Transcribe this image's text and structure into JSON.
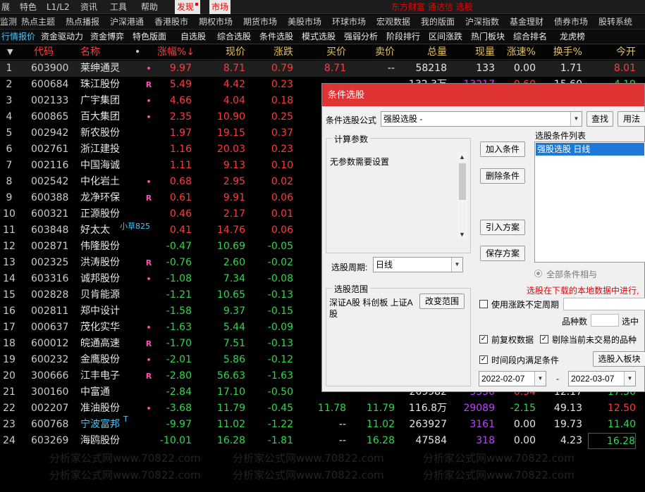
{
  "menu": {
    "items": [
      "展",
      "特色",
      "L1/L2",
      "资讯",
      "工具",
      "帮助",
      "发现",
      "市场"
    ],
    "title": "东方财富 通达信 选股"
  },
  "topics": [
    "监测",
    "热点主题",
    "热点播报",
    "沪深港通",
    "香港股市",
    "期权市场",
    "期货市场",
    "美股市场",
    "环球市场",
    "宏观数据",
    "我的版面",
    "沪深指数",
    "基金理财",
    "债券市场",
    "股转系统"
  ],
  "tabs": [
    "行情报价",
    "资金驱动力",
    "资金博弈",
    "特色版面",
    "自选股",
    "综合选股",
    "条件选股",
    "模式选股",
    "强弱分析",
    "阶段排行",
    "区间涨跌",
    "热门板块",
    "综合排名",
    "龙虎榜"
  ],
  "table": {
    "headers": {
      "idx": "▼",
      "code": "代码",
      "name": "名称",
      "dot": "•",
      "chg": "涨幅%↓",
      "price": "现价",
      "diff": "涨跌",
      "buy": "买价",
      "sell": "卖价",
      "vol": "总量",
      "now": "现量",
      "speed": "涨速%",
      "turn": "换手%",
      "open": "今开"
    },
    "rows": [
      {
        "idx": "1",
        "code": "603900",
        "name": "莱绅通灵",
        "mark": "•",
        "chg": "9.97",
        "price": "8.71",
        "diff": "0.79",
        "buy": "8.71",
        "sell": "--",
        "vol": "58218",
        "now": "133",
        "speed": "0.00",
        "turn": "1.71",
        "open": "8.01"
      },
      {
        "idx": "2",
        "code": "600684",
        "name": "珠江股份",
        "mark": "R",
        "chg": "5.49",
        "price": "4.42",
        "diff": "0.23",
        "buy": "",
        "sell": "",
        "vol": "",
        "now": "",
        "speed": "",
        "turn": "",
        "open": ""
      },
      {
        "idx": "3",
        "code": "002133",
        "name": "广宇集团",
        "mark": "•",
        "chg": "4.66",
        "price": "4.04",
        "diff": "0.18",
        "buy": "",
        "sell": "",
        "vol": "",
        "now": "",
        "speed": "",
        "turn": "",
        "open": ""
      },
      {
        "idx": "4",
        "code": "600865",
        "name": "百大集团",
        "mark": "•",
        "chg": "2.35",
        "price": "10.90",
        "diff": "0.25",
        "buy": "",
        "sell": "",
        "vol": "",
        "now": "",
        "speed": "",
        "turn": "",
        "open": ""
      },
      {
        "idx": "5",
        "code": "002942",
        "name": "新农股份",
        "mark": "",
        "chg": "1.97",
        "price": "19.15",
        "diff": "0.37",
        "buy": "",
        "sell": "",
        "vol": "",
        "now": "",
        "speed": "",
        "turn": "",
        "open": ""
      },
      {
        "idx": "6",
        "code": "002761",
        "name": "浙江建投",
        "mark": "",
        "chg": "1.16",
        "price": "20.03",
        "diff": "0.23",
        "buy": "",
        "sell": "",
        "vol": "",
        "now": "",
        "speed": "",
        "turn": "",
        "open": ""
      },
      {
        "idx": "7",
        "code": "002116",
        "name": "中国海诚",
        "mark": "",
        "chg": "1.11",
        "price": "9.13",
        "diff": "0.10",
        "buy": "",
        "sell": "",
        "vol": "",
        "now": "",
        "speed": "",
        "turn": "",
        "open": ""
      },
      {
        "idx": "8",
        "code": "002542",
        "name": "中化岩土",
        "mark": "•",
        "chg": "0.68",
        "price": "2.95",
        "diff": "0.02",
        "buy": "",
        "sell": "",
        "vol": "",
        "now": "",
        "speed": "",
        "turn": "",
        "open": ""
      },
      {
        "idx": "9",
        "code": "600388",
        "name": "龙净环保",
        "mark": "R",
        "chg": "0.61",
        "price": "9.91",
        "diff": "0.06",
        "buy": "",
        "sell": "",
        "vol": "",
        "now": "",
        "speed": "",
        "turn": "",
        "open": ""
      },
      {
        "idx": "10",
        "code": "600321",
        "name": "正源股份",
        "mark": "",
        "chg": "0.46",
        "price": "2.17",
        "diff": "0.01",
        "buy": "",
        "sell": "",
        "vol": "",
        "now": "",
        "speed": "",
        "turn": "",
        "open": ""
      },
      {
        "idx": "11",
        "code": "603848",
        "name": "好太太",
        "mark": "",
        "chg": "0.41",
        "price": "14.76",
        "diff": "0.06",
        "buy": "",
        "sell": "",
        "vol": "",
        "now": "",
        "speed": "",
        "turn": "",
        "open": ""
      },
      {
        "idx": "12",
        "code": "002871",
        "name": "伟隆股份",
        "mark": "",
        "chg": "-0.47",
        "price": "10.69",
        "diff": "-0.05",
        "buy": "",
        "sell": "",
        "vol": "",
        "now": "",
        "speed": "",
        "turn": "",
        "open": ""
      },
      {
        "idx": "13",
        "code": "002325",
        "name": "洪涛股份",
        "mark": "R",
        "chg": "-0.76",
        "price": "2.60",
        "diff": "-0.02",
        "buy": "",
        "sell": "",
        "vol": "",
        "now": "",
        "speed": "",
        "turn": "",
        "open": ""
      },
      {
        "idx": "14",
        "code": "603316",
        "name": "诚邦股份",
        "mark": "•",
        "chg": "-1.08",
        "price": "7.34",
        "diff": "-0.08",
        "buy": "",
        "sell": "",
        "vol": "",
        "now": "",
        "speed": "",
        "turn": "",
        "open": ""
      },
      {
        "idx": "15",
        "code": "002828",
        "name": "贝肯能源",
        "mark": "",
        "chg": "-1.21",
        "price": "10.65",
        "diff": "-0.13",
        "buy": "",
        "sell": "",
        "vol": "",
        "now": "",
        "speed": "",
        "turn": "",
        "open": ""
      },
      {
        "idx": "16",
        "code": "002811",
        "name": "郑中设计",
        "mark": "",
        "chg": "-1.58",
        "price": "9.37",
        "diff": "-0.15",
        "buy": "",
        "sell": "",
        "vol": "",
        "now": "",
        "speed": "",
        "turn": "",
        "open": ""
      },
      {
        "idx": "17",
        "code": "000637",
        "name": "茂化实华",
        "mark": "•",
        "chg": "-1.63",
        "price": "5.44",
        "diff": "-0.09",
        "buy": "",
        "sell": "",
        "vol": "",
        "now": "",
        "speed": "",
        "turn": "",
        "open": ""
      },
      {
        "idx": "18",
        "code": "600012",
        "name": "皖通高速",
        "mark": "R",
        "chg": "-1.70",
        "price": "7.51",
        "diff": "-0.13",
        "buy": "",
        "sell": "",
        "vol": "",
        "now": "",
        "speed": "",
        "turn": "",
        "open": ""
      },
      {
        "idx": "19",
        "code": "600232",
        "name": "金鹰股份",
        "mark": "•",
        "chg": "-2.01",
        "price": "5.86",
        "diff": "-0.12",
        "buy": "",
        "sell": "",
        "vol": "",
        "now": "",
        "speed": "",
        "turn": "",
        "open": ""
      },
      {
        "idx": "20",
        "code": "300666",
        "name": "江丰电子",
        "mark": "R",
        "chg": "-2.80",
        "price": "56.63",
        "diff": "-1.63",
        "buy": "",
        "sell": "",
        "vol": "",
        "now": "",
        "speed": "",
        "turn": "",
        "open": ""
      },
      {
        "idx": "21",
        "code": "300160",
        "name": "中富通",
        "mark": "",
        "chg": "-2.84",
        "price": "17.10",
        "diff": "-0.50",
        "buy": "",
        "sell": "",
        "vol": "",
        "now": "",
        "speed": "",
        "turn": "",
        "open": ""
      },
      {
        "idx": "22",
        "code": "002207",
        "name": "准油股份",
        "mark": "•",
        "chg": "-3.68",
        "price": "11.79",
        "diff": "-0.45",
        "buy": "11.78",
        "sell": "11.79",
        "vol": "116.8万",
        "now": "29089",
        "speed": "-2.15",
        "turn": "49.13",
        "open": "12.50"
      },
      {
        "idx": "23",
        "code": "600768",
        "name": "宁波富邦",
        "mark": "",
        "chg": "-9.97",
        "price": "11.02",
        "diff": "-1.22",
        "buy": "--",
        "sell": "11.02",
        "vol": "263927",
        "now": "3161",
        "speed": "0.00",
        "turn": "19.73",
        "open": "11.40"
      },
      {
        "idx": "24",
        "code": "603269",
        "name": "海鸥股份",
        "mark": "",
        "chg": "-10.01",
        "price": "16.28",
        "diff": "-1.81",
        "buy": "--",
        "sell": "16.28",
        "vol": "47584",
        "now": "318",
        "speed": "0.00",
        "turn": "4.23",
        "open": "16.28"
      }
    ],
    "partial": {
      "row2_vol": "132.3万",
      "row2_now": "13217",
      "row2_speed": "0.60",
      "row2_turn": "15.60",
      "row2_open": "4.19",
      "row21_vol": "209982",
      "row21_now": "3350",
      "row21_speed": "0.34",
      "row21_turn": "12.17",
      "row21_open": "17.50"
    },
    "badge_row11": "小草825",
    "badge_row23": "T"
  },
  "dialog": {
    "title": "条件选股",
    "formula_label": "条件选股公式",
    "formula_value": "强股选股    -",
    "find_button": "查找",
    "usage_button": "用法",
    "params_group": "计算参数",
    "params_text": "无参数需要设置",
    "add_button": "加入条件",
    "delete_button": "删除条件",
    "import_button": "引入方案",
    "save_button": "保存方案",
    "list_label": "选股条件列表",
    "list_item": "强股选股  日线",
    "all_conditions": "全部条件相与",
    "period_label": "选股周期:",
    "period_value": "日线",
    "scope_group": "选股范围",
    "scope_text": "深证A股 科创板 上证A股",
    "change_scope_button": "改变范围",
    "note_red": "选股在下载的本地数据中进行,",
    "use_period_label": "使用涨跌不定周期",
    "varieties_label": "品种数",
    "selected_label": "选中",
    "fq_label": "前复权数据",
    "exclude_label": "剔除当前未交易的品种",
    "time_label": "时间段内满足条件",
    "date_from": "2022-02-07",
    "date_to": "2022-03-07",
    "date_dash": "-",
    "to_block_button": "选股入板块"
  },
  "watermark": "分析家公式网www.70822.com",
  "colors": {
    "up": "#ff3a3a",
    "down": "#2fd84a",
    "header": "#e3c15a",
    "accent": "#3ec9ff",
    "dialog_title": "#e03434"
  }
}
